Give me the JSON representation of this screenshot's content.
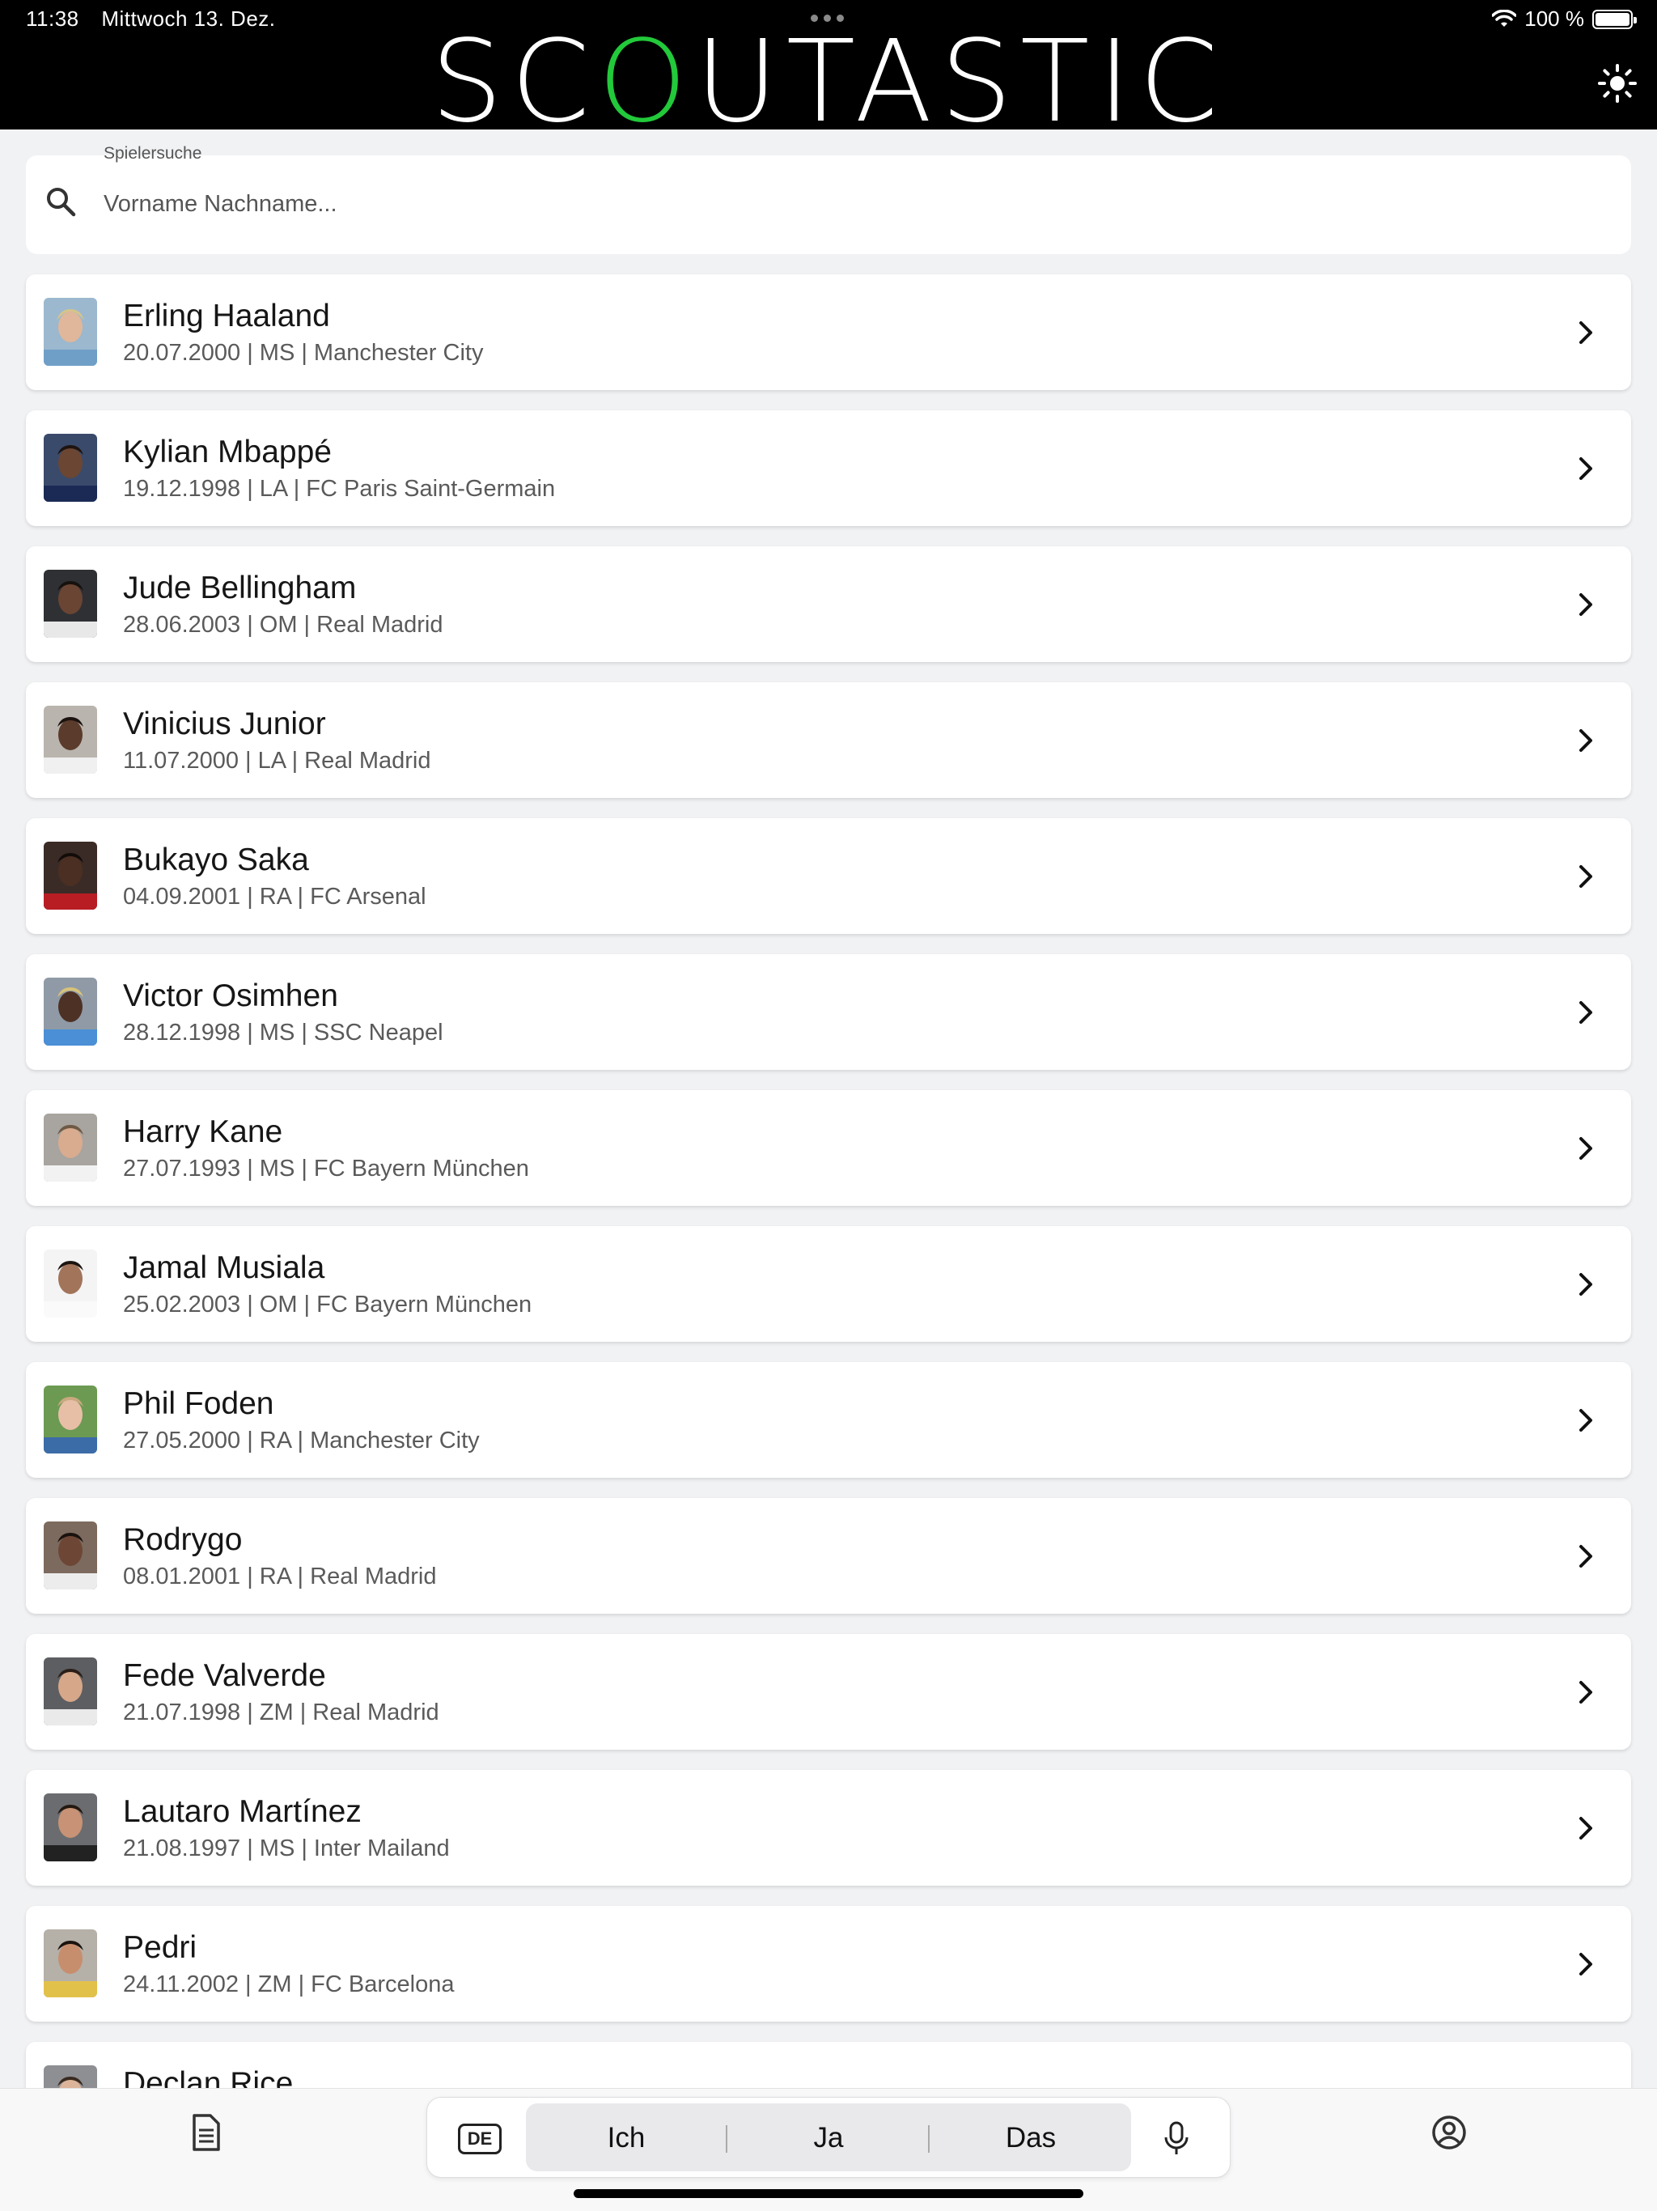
{
  "status_bar": {
    "time": "11:38",
    "date": "Mittwoch 13. Dez.",
    "battery": "100 %"
  },
  "header": {
    "logo_pre": "SC",
    "logo_o": "O",
    "logo_post": "UTASTIC",
    "accent_color": "#22c93a",
    "theme_icon": "sun-icon"
  },
  "search": {
    "label": "Spielersuche",
    "placeholder": "Vorname Nachname..."
  },
  "players": [
    {
      "name": "Erling Haaland",
      "meta": "20.07.2000 | MS | Manchester City"
    },
    {
      "name": "Kylian Mbappé",
      "meta": "19.12.1998 | LA | FC Paris Saint-Germain"
    },
    {
      "name": "Jude Bellingham",
      "meta": "28.06.2003 | OM | Real Madrid"
    },
    {
      "name": "Vinicius Junior",
      "meta": "11.07.2000 | LA | Real Madrid"
    },
    {
      "name": "Bukayo Saka",
      "meta": "04.09.2001 | RA | FC Arsenal"
    },
    {
      "name": "Victor Osimhen",
      "meta": "28.12.1998 | MS | SSC Neapel"
    },
    {
      "name": "Harry Kane",
      "meta": "27.07.1993 | MS | FC Bayern München"
    },
    {
      "name": "Jamal Musiala",
      "meta": "25.02.2003 | OM | FC Bayern München"
    },
    {
      "name": "Phil Foden",
      "meta": "27.05.2000 | RA | Manchester City"
    },
    {
      "name": "Rodrygo",
      "meta": "08.01.2001 | RA | Real Madrid"
    },
    {
      "name": "Fede Valverde",
      "meta": "21.07.1998 | ZM | Real Madrid"
    },
    {
      "name": "Lautaro Martínez",
      "meta": "21.08.1997 | MS | Inter Mailand"
    },
    {
      "name": "Pedri",
      "meta": "24.11.2002 | ZM | FC Barcelona"
    },
    {
      "name": "Declan Rice",
      "meta": ""
    }
  ],
  "keyboard_bar": {
    "lang": "DE",
    "suggestions": [
      "Ich",
      "Ja",
      "Das"
    ]
  },
  "bottom_nav": {
    "left_icon": "notes-icon",
    "right_icon": "profile-icon"
  }
}
